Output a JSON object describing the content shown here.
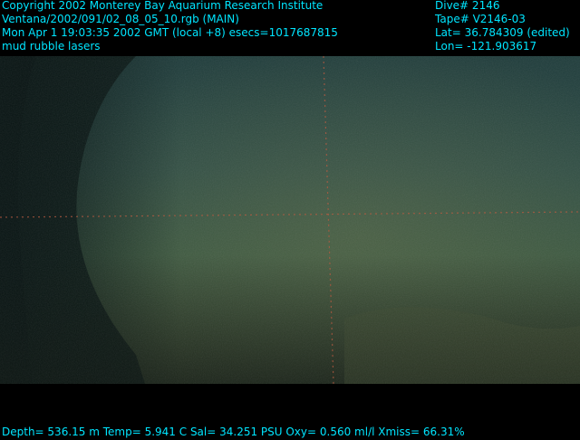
{
  "overlay": {
    "text_color": "#00e5ff",
    "top_left": [
      "Copyright 2002 Monterey Bay Aquarium Research Institute",
      "Ventana/2002/091/02_08_05_10.rgb (MAIN)",
      "Mon Apr  1 19:03:35 2002 GMT (local +8)  esecs=1017687815",
      "mud rubble lasers"
    ],
    "top_right": [
      "Dive# 2146",
      "Tape# V2146-03",
      "Lat= 36.784309 (edited)",
      "Lon= -121.903617"
    ],
    "bottom": "Depth= 536.15 m  Temp= 5.941 C  Sal= 34.251 PSU  Oxy= 0.560 ml/l  Xmiss= 66.31%"
  },
  "scene": {
    "description_colors": {
      "water_top": "#23413f",
      "water_mid": "#2f5046",
      "seafloor": "#4e5a3a",
      "vignette": "#061211",
      "laser": "#b8553a"
    }
  }
}
